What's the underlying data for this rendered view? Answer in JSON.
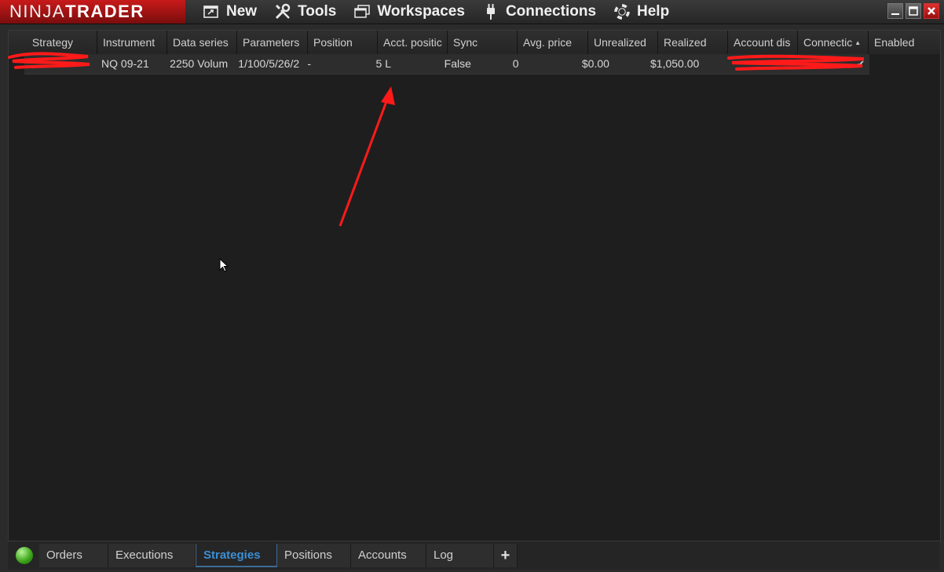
{
  "app": {
    "logo_part1": "NINJA",
    "logo_part2": "TRADER"
  },
  "menu": [
    {
      "label": "New",
      "icon": "new-window-icon"
    },
    {
      "label": "Tools",
      "icon": "tools-icon"
    },
    {
      "label": "Workspaces",
      "icon": "workspaces-icon"
    },
    {
      "label": "Connections",
      "icon": "plug-icon"
    },
    {
      "label": "Help",
      "icon": "lifebuoy-icon"
    }
  ],
  "grid": {
    "columns": [
      "Strategy",
      "Instrument",
      "Data series",
      "Parameters",
      "Position",
      "Acct. positic",
      "Sync",
      "Avg. price",
      "Unrealized",
      "Realized",
      "Account dis",
      "Connectic",
      "Enabled"
    ],
    "sorted_column": "Connectic",
    "rows": [
      {
        "instrument": "NQ 09-21",
        "data_series": "2250 Volum",
        "parameters": "1/100/5/26/2",
        "position": "-",
        "acct_position": "5 L",
        "sync": "False",
        "avg_price": "0",
        "unrealized": "$0.00",
        "realized": "$1,050.00",
        "enabled": true
      }
    ]
  },
  "tabs": [
    {
      "label": "Orders",
      "active": false
    },
    {
      "label": "Executions",
      "active": false
    },
    {
      "label": "Strategies",
      "active": true
    },
    {
      "label": "Positions",
      "active": false
    },
    {
      "label": "Accounts",
      "active": false
    },
    {
      "label": "Log",
      "active": false
    }
  ],
  "tab_add_label": "+",
  "colors": {
    "brand_red": "#c81a1a",
    "active_tab": "#3a8fd6",
    "annotation_red": "#ff1a1a",
    "status_green": "#3fa81c"
  }
}
